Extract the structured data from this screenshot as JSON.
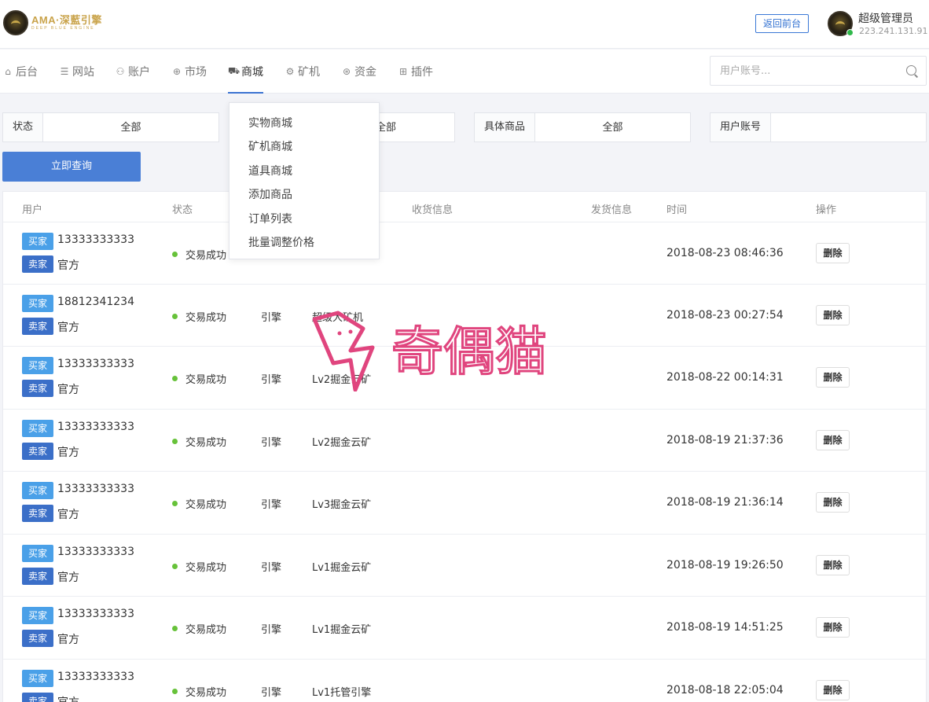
{
  "header": {
    "logo_text": "AMA·深藍引擎",
    "logo_sub": "DEEP BLUE ENGINE",
    "back_button": "返回前台",
    "user_name": "超级管理员",
    "user_ip": "223.241.131.91"
  },
  "nav": {
    "items": [
      {
        "label": "后台",
        "icon": "home-icon"
      },
      {
        "label": "网站",
        "icon": "list-icon"
      },
      {
        "label": "账户",
        "icon": "users-icon"
      },
      {
        "label": "市场",
        "icon": "globe-icon"
      },
      {
        "label": "商城",
        "icon": "cart-icon"
      },
      {
        "label": "矿机",
        "icon": "chip-icon"
      },
      {
        "label": "资金",
        "icon": "coin-icon"
      },
      {
        "label": "插件",
        "icon": "grid-icon"
      }
    ],
    "active": "商城",
    "search_placeholder": "用户账号..."
  },
  "dropdown": {
    "items": [
      "实物商城",
      "矿机商城",
      "道具商城",
      "添加商品",
      "订单列表",
      "批量调整价格"
    ]
  },
  "filters": [
    {
      "label": "状态",
      "value": "全部"
    },
    {
      "label": "",
      "value": "全部"
    },
    {
      "label": "具体商品",
      "value": "全部"
    },
    {
      "label": "用户账号",
      "value": ""
    }
  ],
  "query_button": "立即查询",
  "table": {
    "headers": [
      "用户",
      "状态",
      "收货信息",
      "发货信息",
      "时间",
      "操作"
    ],
    "buyer_tag": "买家",
    "seller_tag": "卖家",
    "delete_label": "删除",
    "rows": [
      {
        "buyer": "13333333333",
        "seller": "官方",
        "status": "交易成功",
        "type": "",
        "product": "",
        "time": "2018-08-23 08:46:36"
      },
      {
        "buyer": "18812341234",
        "seller": "官方",
        "status": "交易成功",
        "type": "引擎",
        "product": "超级大矿机",
        "time": "2018-08-23 00:27:54"
      },
      {
        "buyer": "13333333333",
        "seller": "官方",
        "status": "交易成功",
        "type": "引擎",
        "product": "Lv2掘金云矿",
        "time": "2018-08-22 00:14:31"
      },
      {
        "buyer": "13333333333",
        "seller": "官方",
        "status": "交易成功",
        "type": "引擎",
        "product": "Lv2掘金云矿",
        "time": "2018-08-19 21:37:36"
      },
      {
        "buyer": "13333333333",
        "seller": "官方",
        "status": "交易成功",
        "type": "引擎",
        "product": "Lv3掘金云矿",
        "time": "2018-08-19 21:36:14"
      },
      {
        "buyer": "13333333333",
        "seller": "官方",
        "status": "交易成功",
        "type": "引擎",
        "product": "Lv1掘金云矿",
        "time": "2018-08-19 19:26:50"
      },
      {
        "buyer": "13333333333",
        "seller": "官方",
        "status": "交易成功",
        "type": "引擎",
        "product": "Lv1掘金云矿",
        "time": "2018-08-19 14:51:25"
      },
      {
        "buyer": "13333333333",
        "seller": "官方",
        "status": "交易成功",
        "type": "引擎",
        "product": "Lv1托管引擎",
        "time": "2018-08-18 22:05:04"
      }
    ]
  },
  "watermark_text": "奇偶猫",
  "colors": {
    "accent": "#4a7fd6",
    "buyer_tag": "#4aa0e8",
    "seller_tag": "#3b6fc8",
    "success_dot": "#67c23a",
    "watermark": "#e0457e"
  }
}
